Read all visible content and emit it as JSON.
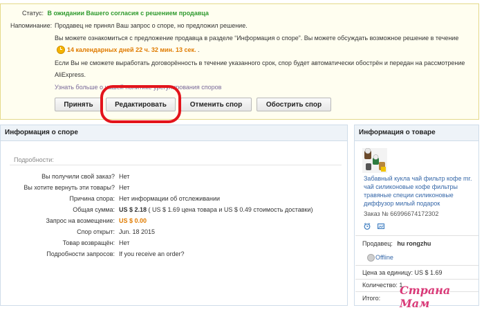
{
  "dispute": {
    "status_label": "Статус:",
    "status_value": "В ожидании Вашего согласия с решением продавца",
    "reminder_label": "Напоминание:",
    "reminder_line1": "Продавец не принял Ваш запрос о споре, но предложил решение.",
    "reminder_line2": "Вы можете ознакомиться с предложение продавца в разделе “Информация о споре”. Вы можете обсуждать возможное решение в течение",
    "timer": "14 календарных дней 22 ч. 32 мин. 13 сек.",
    "timer_suffix": ".",
    "reminder_line3": "Если Вы не сможете выработать договорённость в течение указанного срок, спор будет автоматически обострён и передан на рассмотрение",
    "reminder_line4": "AliExpress.",
    "learn_more": "Узнать больше о нашей политике урегулирования споров",
    "buttons": {
      "accept": "Принять",
      "edit": "Редактировать",
      "cancel": "Отменить спор",
      "escalate": "Обострить спор"
    }
  },
  "info": {
    "title": "Информация о споре",
    "subtitle": "Подробности:",
    "rows": [
      {
        "label": "Вы получили свой заказ?",
        "value": "Нет"
      },
      {
        "label": "Вы хотите вернуть эти товары?",
        "value": "Нет"
      },
      {
        "label": "Причина спора:",
        "value": "Нет информации об отслеживании"
      },
      {
        "label": "Общая сумма:",
        "value_bold": "US $ 2.18",
        "value_rest": "( US $ 1.69 цена товара и US $ 0.49 стоимость доставки)"
      },
      {
        "label": "Запрос на возмещение:",
        "value": "US $ 0.00"
      },
      {
        "label": "Спор открыт:",
        "value": "Jun. 18 2015"
      },
      {
        "label": "Товар возвращён:",
        "value": "Нет"
      },
      {
        "label": "Подробности запросов:",
        "value": "If you receive an order?"
      }
    ]
  },
  "product": {
    "title": "Информация о товаре",
    "name": "Забавный кукла чай фильтр кофе mr. чай силиконовые кофе фильтры травяные специи силиконовые диффузор милый подарок",
    "order": "Заказ № 66996674172302",
    "seller_label": "Продавец:",
    "seller": "hu rongzhu",
    "offline": "Offline",
    "unit_price": "Цена за единицу: US $ 1.69",
    "quantity": "Количество: 1",
    "total": "Итого:"
  },
  "watermark": "Страна Мам",
  "colors": {
    "status": "#2f9a2f",
    "timer": "#e07b00",
    "highlight": "#e3141b"
  }
}
